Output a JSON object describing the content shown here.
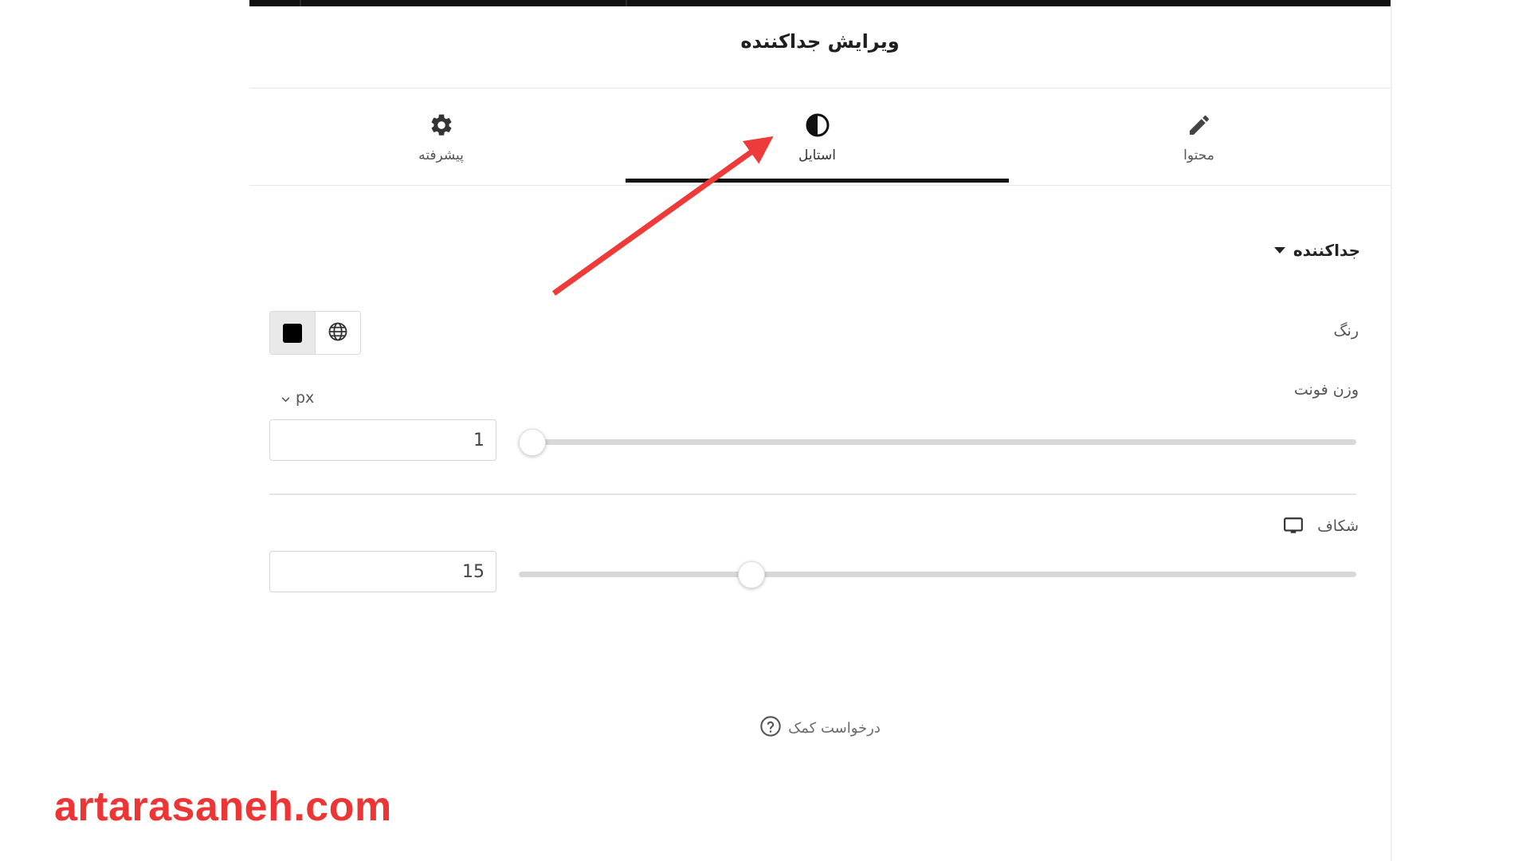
{
  "header": {
    "title": "ویرایش جداکننده"
  },
  "tabs": [
    {
      "label": "پیشرفته",
      "icon": "gear-icon",
      "active": false
    },
    {
      "label": "استایل",
      "icon": "contrast-icon",
      "active": true
    },
    {
      "label": "محتوا",
      "icon": "pencil-icon",
      "active": false
    }
  ],
  "section": {
    "title": "جداکننده"
  },
  "controls": {
    "color_label": "رنگ",
    "color_value": "#000000",
    "weight_label": "وزن فونت",
    "weight_unit": "px",
    "weight_value": "1",
    "weight_fraction": 0.0,
    "gap_label": "شکاف",
    "gap_value": "15",
    "gap_fraction": 0.27
  },
  "help": {
    "label": "درخواست کمک"
  },
  "watermark": {
    "text": "artarasaneh.com",
    "color": "#ee3535"
  },
  "annotation": {
    "arrow_color": "#ef3a3a"
  }
}
